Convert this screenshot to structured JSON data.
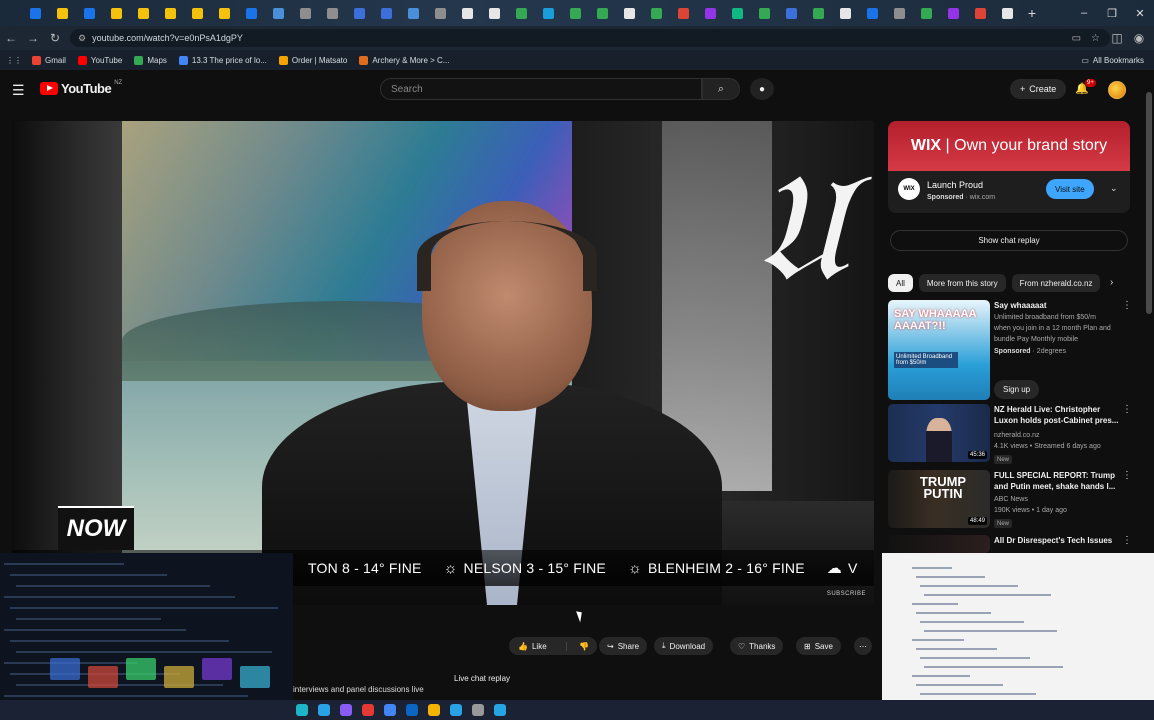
{
  "browser": {
    "url": "youtube.com/watch?v=e0nPsA1dgPY",
    "tab_colors": [
      "#1a73e8",
      "#f4c20d",
      "#1a73e8",
      "#f4c20d",
      "#f4c20d",
      "#f4c20d",
      "#f4c20d",
      "#f4c20d",
      "#1a73e8",
      "#4a90d9",
      "#8e8e8e",
      "#8e8e8e",
      "#3c6fd8",
      "#3c6fd8",
      "#4a90d9",
      "#8e8e8e",
      "#e6e6e6",
      "#e6e6e6",
      "#34a853",
      "#1a9ed9",
      "#34a853",
      "#34a853",
      "#e6e6e6",
      "#34a853",
      "#db4437",
      "#9334e6",
      "#10b981",
      "#34a853",
      "#3c6fd8",
      "#34a853",
      "#e6e6e6",
      "#1a73e8",
      "#8e8e8e",
      "#34a853",
      "#9334e6",
      "#db4437",
      "#e6e6e6"
    ],
    "new_tab": "+",
    "window_controls": [
      "–",
      "❐",
      "✕"
    ],
    "bookmarks": [
      {
        "label": "Gmail",
        "color": "#ea4335"
      },
      {
        "label": "YouTube",
        "color": "#ff0000"
      },
      {
        "label": "Maps",
        "color": "#34a853"
      },
      {
        "label": "13.3 The price of lo...",
        "color": "#4285f4"
      },
      {
        "label": "Order | Matsato",
        "color": "#f4a300"
      },
      {
        "label": "Archery & More > C...",
        "color": "#e06c1f"
      }
    ],
    "all_bookmarks": "All Bookmarks"
  },
  "header": {
    "logo_text": "YouTube",
    "logo_country": "NZ",
    "search_placeholder": "Search",
    "create_label": "Create",
    "notif_count": "9+"
  },
  "player": {
    "now_label": "NOW",
    "ticker": [
      {
        "text": "TON 8 - 14° FINE",
        "icon": ""
      },
      {
        "text": "NELSON 3 - 15° FINE",
        "icon": "☼"
      },
      {
        "text": "BLENHEIM 2 - 16° FINE",
        "icon": "☼"
      },
      {
        "text": "V",
        "icon": "☁"
      }
    ],
    "watermark": "SUBSCRIBE"
  },
  "actions": {
    "like": "Like",
    "share": "Share",
    "download": "Download",
    "thanks": "Thanks",
    "save": "Save",
    "more": "⋯"
  },
  "below": {
    "chat_title": "Live chat replay",
    "desc_snippet": "interviews and panel discussions live"
  },
  "ad": {
    "banner_brand": "WIX",
    "banner_text": "Own your brand story",
    "logo": "WIX",
    "title": "Launch Proud",
    "sponsored": "Sponsored",
    "domain": "wix.com",
    "cta": "Visit site",
    "accent": "#3ea6ff"
  },
  "show_chat": "Show chat replay",
  "chips": [
    "All",
    "More from this story",
    "From nzherald.co.nz"
  ],
  "recommendations": [
    {
      "title": "Say whaaaaat",
      "lines": [
        "Unlimited broadband from $50/m",
        "when you join in a 12 month Plan and",
        "bundle Pay Monthly mobile"
      ],
      "sponsored": "Sponsored",
      "advertiser": "2degrees",
      "cta": "Sign up",
      "thumb_text": "SAY WHAAAAA AAAAT?!!",
      "thumb_sub": "Unlimited Broadband from $50/m"
    },
    {
      "title": "NZ Herald Live: Christopher Luxon holds post-Cabinet pres...",
      "channel": "nzherald.co.nz",
      "meta": "4.1K views • Streamed 6 days ago",
      "badge": "New",
      "duration": "45:36"
    },
    {
      "title": "FULL SPECIAL REPORT: Trump and Putin meet, shake hands l...",
      "channel": "ABC News",
      "meta": "190K views • 1 day ago",
      "badge": "New",
      "duration": "48:49",
      "thumb_text": "TRUMP PUTIN"
    },
    {
      "title": "All Dr Disrespect's Tech Issues"
    }
  ]
}
